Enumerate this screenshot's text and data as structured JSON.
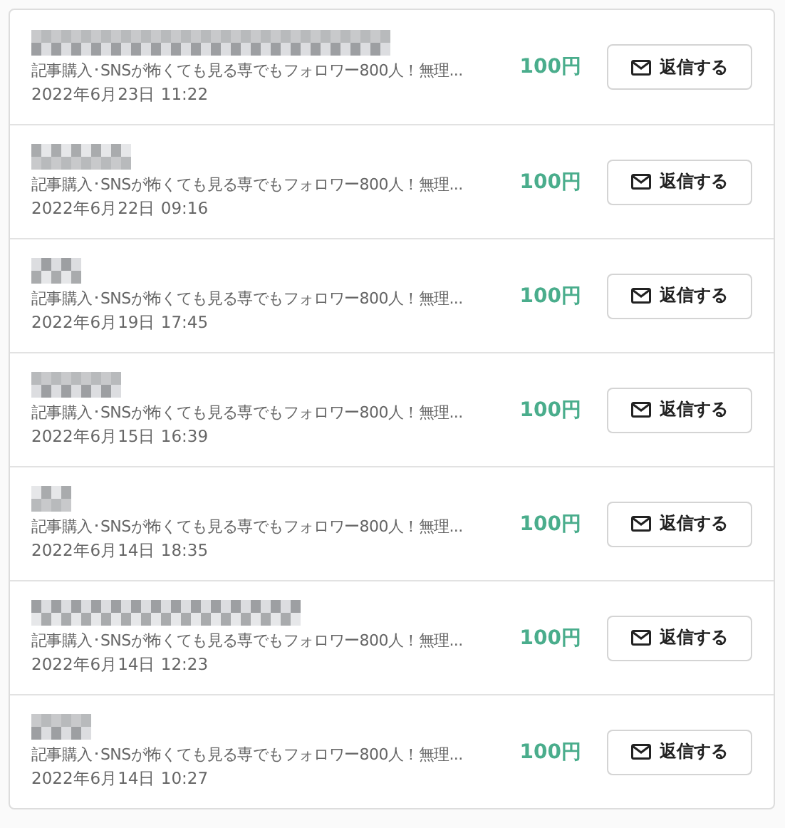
{
  "messages": [
    {
      "summary": "記事購入･SNSが怖くても見る専でもフォロワー800人！無理...",
      "date": "2022年6月23日 11:22",
      "price": "100円",
      "reply_button": "返信する"
    },
    {
      "summary": "記事購入･SNSが怖くても見る専でもフォロワー800人！無理...",
      "date": "2022年6月22日 09:16",
      "price": "100円",
      "reply_button": "返信する"
    },
    {
      "summary": "記事購入･SNSが怖くても見る専でもフォロワー800人！無理...",
      "date": "2022年6月19日 17:45",
      "price": "100円",
      "reply_button": "返信する"
    },
    {
      "summary": "記事購入･SNSが怖くても見る専でもフォロワー800人！無理...",
      "date": "2022年6月15日 16:39",
      "price": "100円",
      "reply_button": "返信する"
    },
    {
      "summary": "記事購入･SNSが怖くても見る専でもフォロワー800人！無理...",
      "date": "2022年6月14日 18:35",
      "price": "100円",
      "reply_button": "返信する"
    },
    {
      "summary": "記事購入･SNSが怖くても見る専でもフォロワー800人！無理...",
      "date": "2022年6月14日 12:23",
      "price": "100円",
      "reply_button": "返信する"
    },
    {
      "summary": "記事購入･SNSが怖くても見る専でもフォロワー800人！無理...",
      "date": "2022年6月14日 10:27",
      "price": "100円",
      "reply_button": "返信する"
    }
  ]
}
